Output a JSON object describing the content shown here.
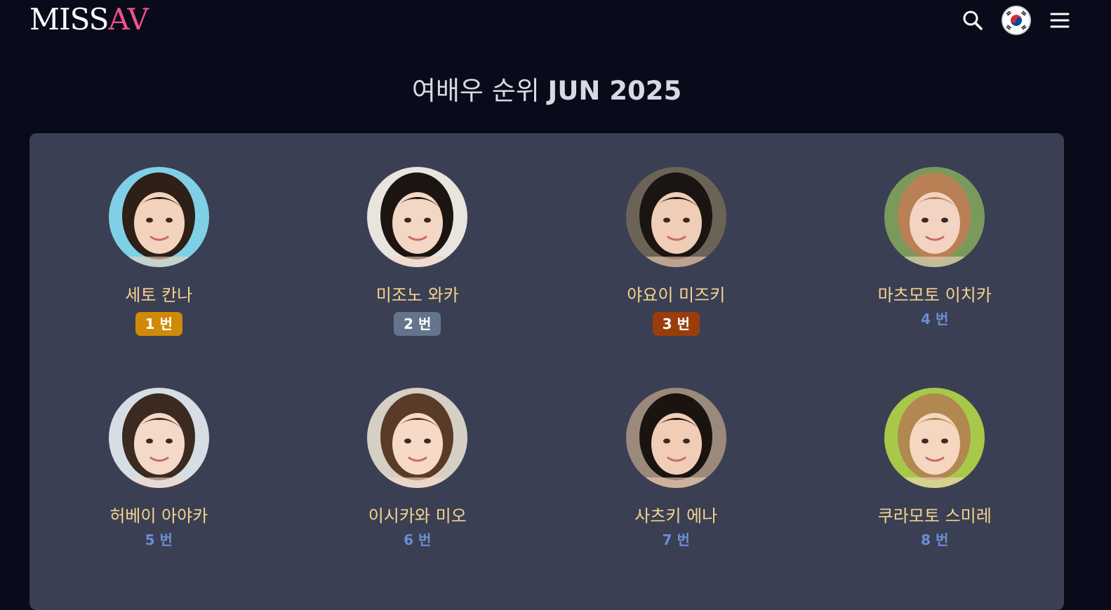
{
  "header": {
    "logo_miss": "MISS",
    "logo_av": "AV"
  },
  "icons": {
    "search": "search-icon",
    "language": "korea-flag-icon",
    "menu": "hamburger-menu-icon"
  },
  "page": {
    "title_light": "여배우 순위",
    "title_bold": "JUN 2025"
  },
  "colors": {
    "background": "#090a1a",
    "panel": "#3b3f53",
    "name": "#f5d48f",
    "rank_text": "#6b8ed6",
    "logo_accent": "#f05289",
    "gold": "#d08a07",
    "silver": "#64748b",
    "bronze": "#9a3d0c"
  },
  "actresses": [
    {
      "name": "세토 칸나",
      "rank": "1 번",
      "badge": "gold"
    },
    {
      "name": "미조노 와카",
      "rank": "2 번",
      "badge": "silver"
    },
    {
      "name": "야요이 미즈키",
      "rank": "3 번",
      "badge": "bronze"
    },
    {
      "name": "마츠모토 이치카",
      "rank": "4 번",
      "badge": ""
    },
    {
      "name": "허베이 아야카",
      "rank": "5 번",
      "badge": ""
    },
    {
      "name": "이시카와 미오",
      "rank": "6 번",
      "badge": ""
    },
    {
      "name": "사츠키 에나",
      "rank": "7 번",
      "badge": ""
    },
    {
      "name": "쿠라모토 스미레",
      "rank": "8 번",
      "badge": ""
    }
  ]
}
